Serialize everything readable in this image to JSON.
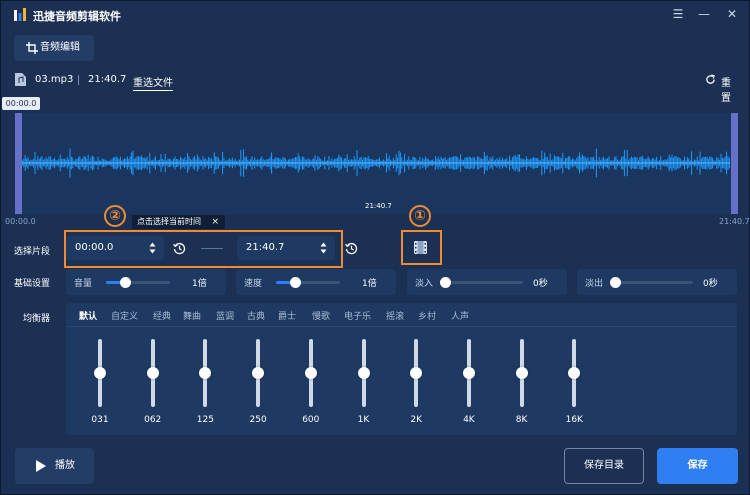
{
  "window": {
    "title": "迅捷音频剪辑软件",
    "icons": [
      "app-logo-icon",
      "menu-icon",
      "minimize-icon",
      "close-icon"
    ]
  },
  "tab": {
    "label": "音频编辑",
    "icon": "crop-icon"
  },
  "file": {
    "name": "03.mp3",
    "duration": "21:40.7",
    "reselect_label": "重选文件",
    "reset_label": "重置"
  },
  "waveform": {
    "current_time_tag": "00:00.0",
    "cursor_time": "21:40.7",
    "start_time": "00:00.0",
    "end_time": "21:40.7",
    "color": "#1e9bff"
  },
  "tooltip": {
    "text": "点击选择当前时间",
    "close": "×"
  },
  "annotations": {
    "marker1": "①",
    "marker2": "②",
    "color": "#f08a33"
  },
  "segment": {
    "label": "选择片段",
    "start": "00:00.0",
    "end": "21:40.7"
  },
  "basic": {
    "label": "基础设置",
    "volume": {
      "label": "音量",
      "value": "1倍",
      "level": 0.3
    },
    "speed": {
      "label": "速度",
      "value": "1倍",
      "level": 0.3
    },
    "fade_in": {
      "label": "淡入",
      "value": "0秒",
      "level": 0.0
    },
    "fade_out": {
      "label": "淡出",
      "value": "0秒",
      "level": 0.0
    }
  },
  "equalizer": {
    "label": "均衡器",
    "presets": [
      "默认",
      "自定义",
      "经典",
      "舞曲",
      "蓝调",
      "古典",
      "爵士",
      "慢歌",
      "电子乐",
      "摇滚",
      "乡村",
      "人声"
    ],
    "active_preset": "默认",
    "bands": [
      {
        "freq": "031",
        "level": 0.5
      },
      {
        "freq": "062",
        "level": 0.5
      },
      {
        "freq": "125",
        "level": 0.5
      },
      {
        "freq": "250",
        "level": 0.5
      },
      {
        "freq": "600",
        "level": 0.5
      },
      {
        "freq": "1K",
        "level": 0.5
      },
      {
        "freq": "2K",
        "level": 0.5
      },
      {
        "freq": "4K",
        "level": 0.5
      },
      {
        "freq": "8K",
        "level": 0.5
      },
      {
        "freq": "16K",
        "level": 0.5
      }
    ]
  },
  "actions": {
    "play": "播放",
    "save_dir": "保存目录",
    "save": "保存"
  },
  "colors": {
    "background": "#1b3053",
    "panel": "#1e3a63",
    "accent": "#2f7ef2"
  }
}
